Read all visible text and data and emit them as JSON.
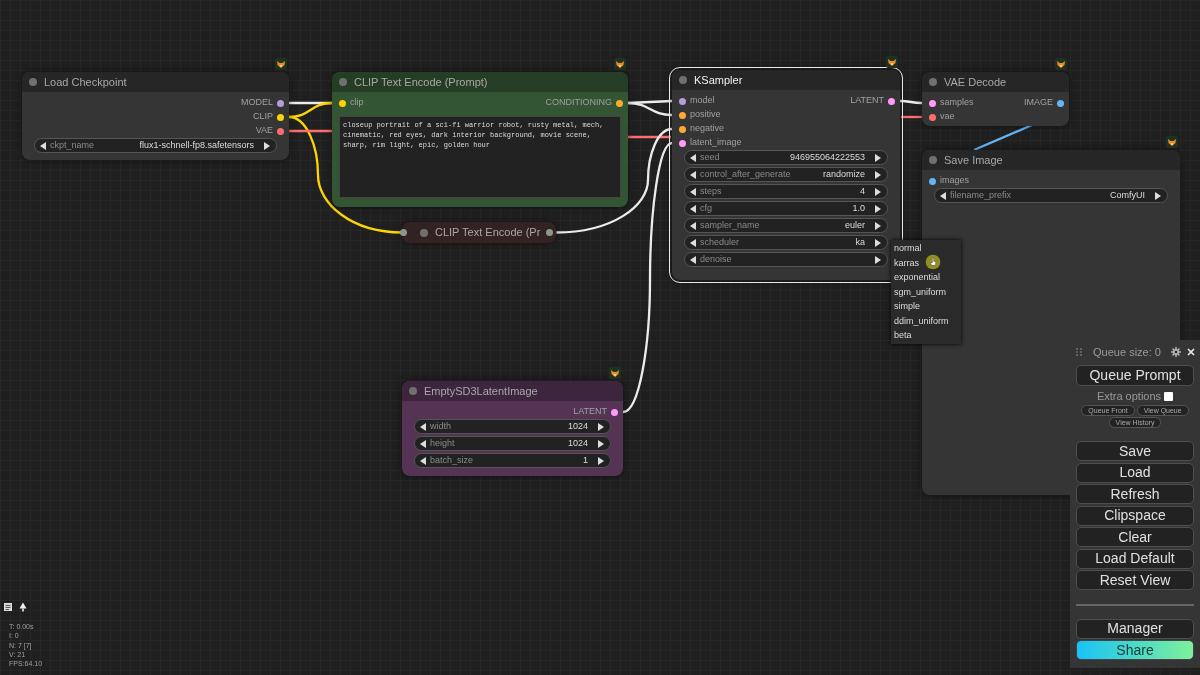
{
  "nodes": [
    {
      "title": "Load Checkpoint",
      "color": "#353535",
      "collapsed": false,
      "selected": false,
      "outputs": [
        {
          "label": "MODEL",
          "kind": "model"
        },
        {
          "label": "CLIP",
          "kind": "clip"
        },
        {
          "label": "VAE",
          "kind": "vae"
        }
      ],
      "widgets": [
        {
          "label": "ckpt_name",
          "value": "flux1-schnell-fp8.safetensors"
        }
      ]
    },
    {
      "title": "CLIP Text Encode (Prompt)",
      "color": "#335533",
      "collapsed": false,
      "selected": false,
      "inputs": [
        {
          "label": "clip",
          "kind": "clip"
        }
      ],
      "outputs": [
        {
          "label": "CONDITIONING",
          "kind": "conditioning"
        }
      ],
      "prompt": "closeup portrait of a sci-fi warrior robot, rusty metal, mech, cinematic, red eyes, dark interior background, movie scene, sharp, rim light, epic, golden hour"
    },
    {
      "title": "CLIP Text Encode (Pr",
      "color": "#332222",
      "collapsed": true,
      "selected": false
    },
    {
      "title": "KSampler",
      "color": "#353535",
      "collapsed": false,
      "selected": true,
      "inputs": [
        {
          "label": "model",
          "kind": "model"
        },
        {
          "label": "positive",
          "kind": "conditioning"
        },
        {
          "label": "negative",
          "kind": "conditioning"
        },
        {
          "label": "latent_image",
          "kind": "latent"
        }
      ],
      "outputs": [
        {
          "label": "LATENT",
          "kind": "latent"
        }
      ],
      "widgets": [
        {
          "label": "seed",
          "value": "946955064222553"
        },
        {
          "label": "control_after_generate",
          "value": "randomize"
        },
        {
          "label": "steps",
          "value": "4"
        },
        {
          "label": "cfg",
          "value": "1.0"
        },
        {
          "label": "sampler_name",
          "value": "euler"
        },
        {
          "label": "scheduler",
          "value": "ka"
        },
        {
          "label": "denoise"
        }
      ]
    },
    {
      "title": "VAE Decode",
      "color": "#353535",
      "collapsed": false,
      "selected": false,
      "inputs": [
        {
          "label": "samples",
          "kind": "latent"
        },
        {
          "label": "vae",
          "kind": "vae"
        }
      ],
      "outputs": [
        {
          "label": "IMAGE",
          "kind": "image"
        }
      ]
    },
    {
      "title": "Save Image",
      "color": "#353535",
      "collapsed": false,
      "selected": false,
      "inputs": [
        {
          "label": "images",
          "kind": "image"
        }
      ],
      "widgets": [
        {
          "label": "filename_prefix",
          "value": "ComfyUI"
        }
      ]
    },
    {
      "title": "EmptySD3LatentImage",
      "color": "#553355",
      "collapsed": false,
      "selected": false,
      "outputs": [
        {
          "label": "LATENT",
          "kind": "latent"
        }
      ],
      "widgets": [
        {
          "label": "width",
          "value": "1024"
        },
        {
          "label": "height",
          "value": "1024"
        },
        {
          "label": "batch_size",
          "value": "1"
        }
      ]
    }
  ],
  "context_menu": {
    "items": [
      "normal",
      "karras",
      "exponential",
      "sgm_uniform",
      "simple",
      "ddim_uniform",
      "beta"
    ]
  },
  "queue_panel": {
    "title": "Queue size: 0",
    "primary_button": "Queue Prompt",
    "extra_options": {
      "label": "Extra options",
      "checked": false
    },
    "small_buttons": [
      "Queue Front",
      "View Queue",
      "View History"
    ],
    "buttons": [
      "Save",
      "Load",
      "Refresh",
      "Clipspace",
      "Clear",
      "Load Default",
      "Reset View"
    ],
    "bottom_buttons": [
      {
        "label": "Manager",
        "kind": "plain"
      },
      {
        "label": "Share",
        "kind": "gradient"
      }
    ]
  },
  "stats": [
    "T: 0.00s",
    "I: 0",
    "N: 7 [7]",
    "V: 21",
    "FPS:64.10"
  ]
}
